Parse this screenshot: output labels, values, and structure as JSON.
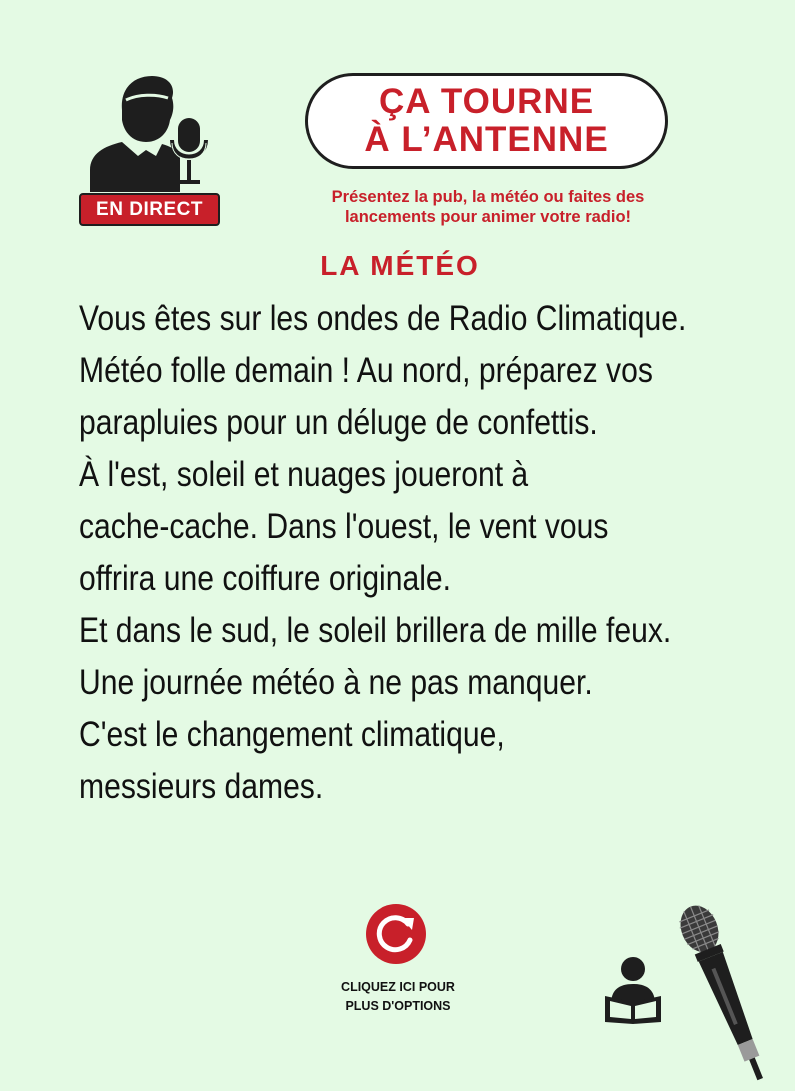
{
  "header": {
    "live_badge": "EN DIRECT",
    "title_line1": "ÇA TOURNE",
    "title_line2": "À L’ANTENNE",
    "subtitle_line1": "Présentez la pub, la météo ou faites des",
    "subtitle_line2": "lancements pour animer votre radio!"
  },
  "section": {
    "title": "LA MÉTÉO"
  },
  "script_lines": [
    "Vous êtes sur les ondes de Radio Climatique.",
    "Météo folle demain ! Au nord, préparez vos",
    "parapluies pour un déluge de confettis.",
    "À l'est, soleil et nuages joueront à",
    "cache-cache. Dans l'ouest, le vent vous",
    "offrira une coiffure originale.",
    "Et dans le sud, le soleil brillera de mille feux.",
    "Une journée météo à ne pas manquer.",
    "C'est le changement climatique,",
    "messieurs dames."
  ],
  "footer": {
    "options_line1": "CLIQUEZ ICI POUR",
    "options_line2": "PLUS D'OPTIONS"
  },
  "icons": {
    "host": "radio-host-icon",
    "reload": "reload-icon",
    "reader": "reader-icon",
    "microphone": "microphone-icon"
  },
  "colors": {
    "background": "#e4fae4",
    "accent_red": "#c8202a",
    "text_dark": "#111111"
  }
}
